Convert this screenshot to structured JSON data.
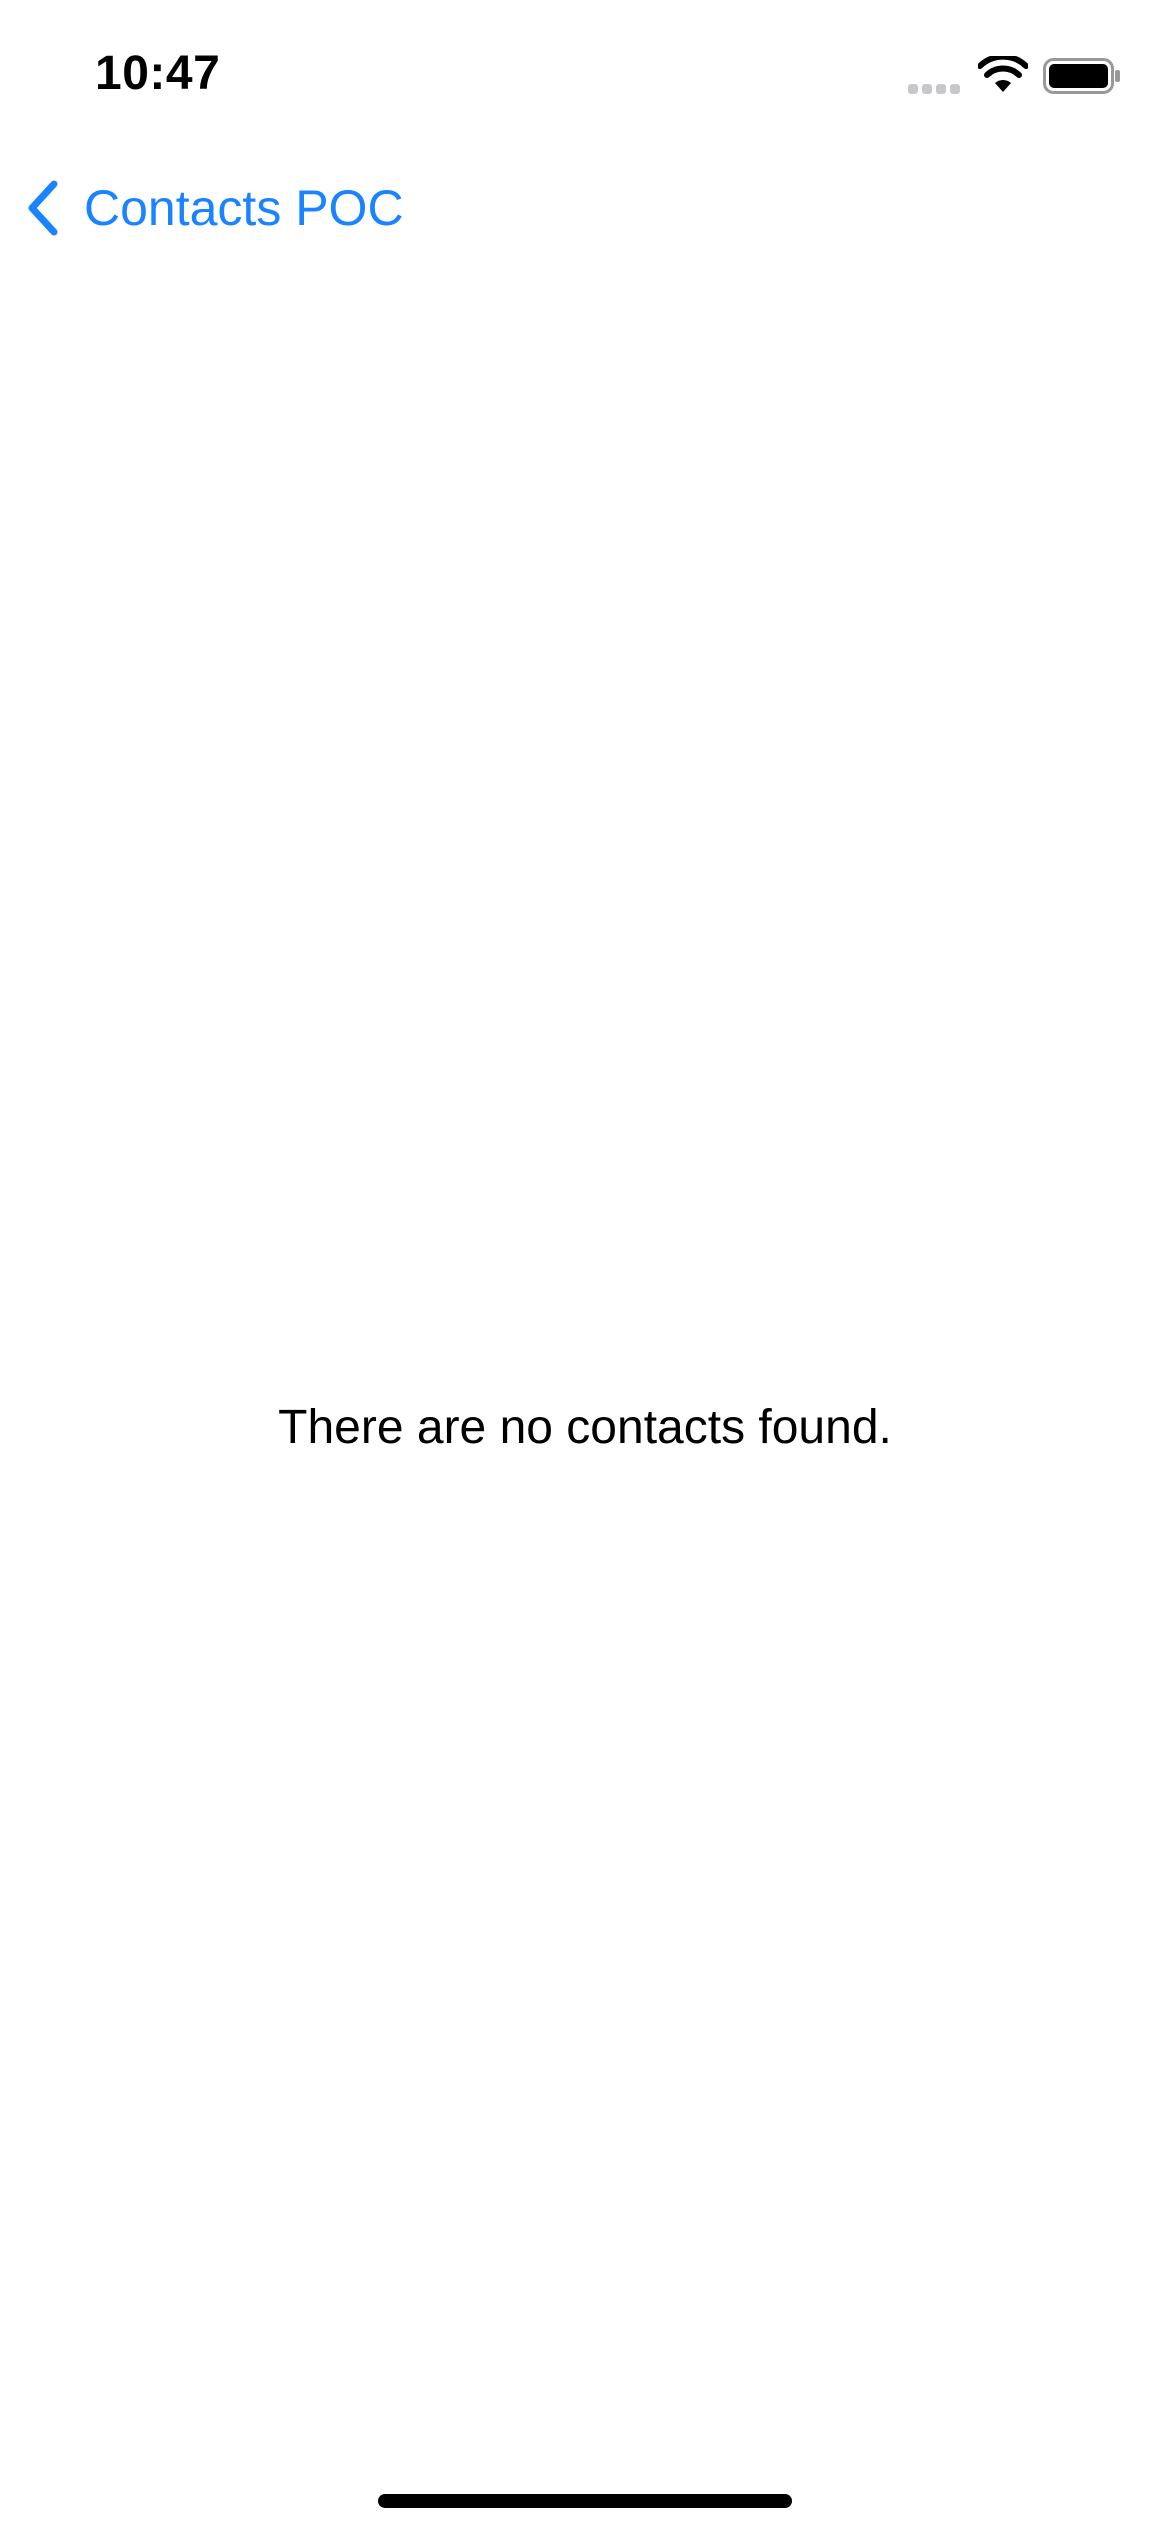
{
  "status_bar": {
    "time": "10:47",
    "signal_icon": "cellular-signal-icon",
    "wifi_icon": "wifi-icon",
    "battery_icon": "battery-icon"
  },
  "nav": {
    "back_icon": "chevron-left-icon",
    "back_label": "Contacts POC",
    "accent_color": "#1a84ff"
  },
  "main": {
    "empty_message": "There are no contacts found."
  }
}
